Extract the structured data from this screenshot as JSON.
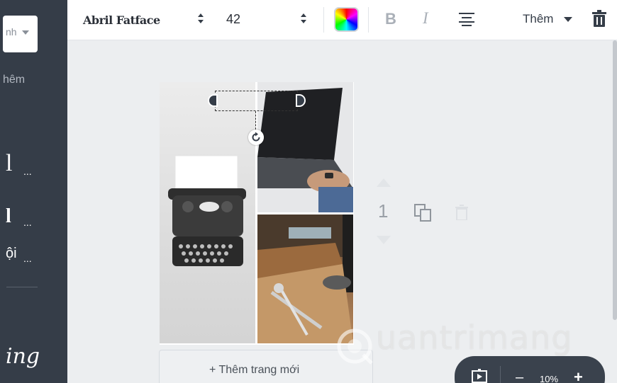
{
  "sidebar": {
    "select_label": "nh",
    "add_label": "hêm",
    "font_items": [
      {
        "label": "l",
        "dots": "..."
      },
      {
        "label": "l",
        "dots": "..."
      },
      {
        "label": "ội",
        "dots": "..."
      },
      {
        "label": "ing"
      }
    ]
  },
  "toolbar": {
    "font_family": "Abril Fatface",
    "font_size": "42",
    "bold_label": "B",
    "italic_label": "I",
    "more_label": "Thêm"
  },
  "page_controls": {
    "page_number": "1"
  },
  "add_page": {
    "label": "+ Thêm trang mới"
  },
  "zoom": {
    "minus": "–",
    "level": "10%",
    "plus": "+"
  },
  "watermark": {
    "text": "uantrimang"
  },
  "icons": {
    "select_caret": "chevron-down-icon",
    "font_stepper": "up-down-arrows-icon",
    "color": "color-picker-icon",
    "align": "align-center-icon",
    "more_caret": "caret-down-icon",
    "delete": "trash-icon",
    "rotate": "rotate-icon",
    "page_up": "arrow-up-icon",
    "page_down": "arrow-down-icon",
    "copy": "copy-page-icon",
    "page_delete": "trash-icon",
    "present": "present-icon"
  },
  "colors": {
    "sidebar_bg": "#353d48",
    "canvas_bg": "#eceef0",
    "toolbar_text": "#353d48",
    "zoom_bar_bg": "#3a424d"
  }
}
